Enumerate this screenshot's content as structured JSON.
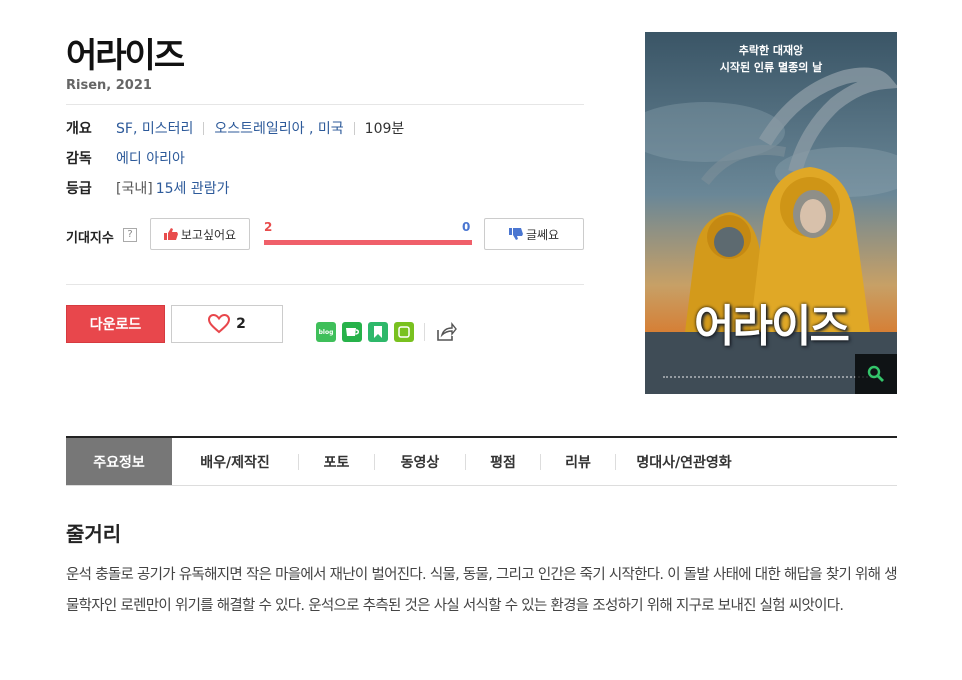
{
  "movie": {
    "title": "어라이즈",
    "subtitle": "Risen, 2021"
  },
  "info": {
    "overview_label": "개요",
    "genre": "SF, 미스터리",
    "country": "오스트레일리아 , 미국",
    "runtime": "109분",
    "director_label": "감독",
    "director": "에디 아리아",
    "rating_label": "등급",
    "rating_prefix": "[국내]",
    "rating": "15세 관람가"
  },
  "expectation": {
    "label": "기대지수",
    "help": "?",
    "like_label": "보고싶어요",
    "dislike_label": "글쎄요",
    "like_count": "2",
    "dislike_count": "0",
    "like_ratio": 1.0
  },
  "actions": {
    "download_label": "다운로드",
    "like_count": "2",
    "share_icons": [
      "blog-icon",
      "cafe-icon",
      "bookmark-icon",
      "band-icon",
      "share-icon"
    ],
    "blog_text": "blog"
  },
  "poster": {
    "tagline_1": "추락한 대재앙",
    "tagline_2": "시작된 인류 멸종의 날",
    "title_text": "어라이즈"
  },
  "tabs": [
    {
      "label": "주요정보",
      "active": true
    },
    {
      "label": "배우/제작진"
    },
    {
      "label": "포토"
    },
    {
      "label": "동영상"
    },
    {
      "label": "평점"
    },
    {
      "label": "리뷰"
    },
    {
      "label": "명대사/연관영화"
    }
  ],
  "plot": {
    "heading": "줄거리",
    "text": "운석 충돌로 공기가 유독해지면 작은 마을에서 재난이 벌어진다. 식물, 동물, 그리고 인간은 죽기 시작한다. 이 돌발 사태에 대한 해답을 찾기 위해 생물학자인 로렌만이 위기를 해결할 수 있다. 운석으로 추측된 것은 사실 서식할 수 있는 환경을 조성하기 위해 지구로 보내진 실험 씨앗이다."
  },
  "colors": {
    "accent_red": "#e8474c",
    "like_red": "#f0606a",
    "dislike_blue": "#4a76d1",
    "link_blue": "#2d5a9a",
    "active_tab": "#777777"
  }
}
